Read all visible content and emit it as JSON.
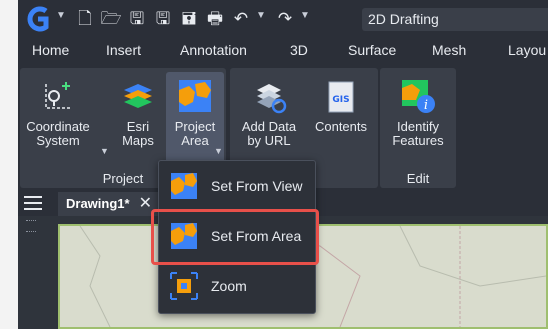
{
  "window": {
    "workspace_label": "2D Drafting"
  },
  "menubar": {
    "items": [
      "Home",
      "Insert",
      "Annotation",
      "3D",
      "Surface",
      "Mesh",
      "Layou"
    ]
  },
  "ribbon": {
    "project_panel": {
      "title": "Project",
      "buttons": [
        {
          "label_line1": "Coordinate",
          "label_line2": "System"
        },
        {
          "label_line1": "Esri",
          "label_line2": "Maps"
        },
        {
          "label_line1": "Project",
          "label_line2": "Area"
        }
      ]
    },
    "contents_panel": {
      "title": "nts",
      "buttons": [
        {
          "label_line1": "Add Data",
          "label_line2": "by URL"
        },
        {
          "label_line1": "Contents",
          "label_line2": ""
        }
      ]
    },
    "edit_panel": {
      "title": "Edit",
      "buttons": [
        {
          "label_line1": "Identify",
          "label_line2": "Features"
        }
      ]
    }
  },
  "document": {
    "tab_label": "Drawing1*"
  },
  "dropdown": {
    "items": [
      {
        "label": "Set From View"
      },
      {
        "label": "Set From Area"
      },
      {
        "label": "Zoom"
      }
    ]
  },
  "colors": {
    "app_bg": "#2b2f38",
    "panel_bg": "#3a3f49",
    "highlight": "#e8504a",
    "brand": "#3b82f6"
  },
  "icons": {
    "app_logo": "gcad-logo-icon",
    "project_area": "map-area-icon",
    "zoom": "zoom-map-icon"
  }
}
